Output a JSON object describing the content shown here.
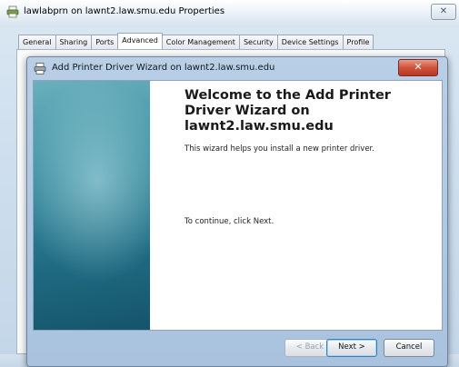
{
  "outer_window": {
    "title": "lawlabprn on lawnt2.law.smu.edu Properties",
    "close_glyph": "✕",
    "tabs": [
      {
        "label": "General"
      },
      {
        "label": "Sharing"
      },
      {
        "label": "Ports"
      },
      {
        "label": "Advanced",
        "active": true
      },
      {
        "label": "Color Management"
      },
      {
        "label": "Security"
      },
      {
        "label": "Device Settings"
      },
      {
        "label": "Profile"
      }
    ]
  },
  "wizard": {
    "title": "Add Printer Driver Wizard on lawnt2.law.smu.edu",
    "close_glyph": "✕",
    "heading": "Welcome to the Add Printer Driver Wizard on lawnt2.law.smu.edu",
    "intro_text": "This wizard helps you install a new printer driver.",
    "continue_text": "To continue, click Next.",
    "buttons": {
      "back": "< Back",
      "next": "Next >",
      "cancel": "Cancel"
    }
  },
  "icons": {
    "outer_window_icon": "printer-icon",
    "wizard_icon": "printer-icon"
  },
  "colors": {
    "side_panel": "#2a7d92",
    "close_button": "#d0523a",
    "default_button_border": "#3c7fb1"
  }
}
